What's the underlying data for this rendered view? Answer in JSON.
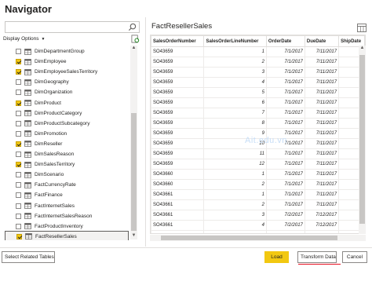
{
  "window": {
    "title": "Navigator"
  },
  "search": {
    "placeholder": ""
  },
  "display_options": {
    "label": "Display Options",
    "caret": "▼"
  },
  "tree": {
    "items": [
      {
        "label": "DimDepartmentGroup",
        "checked": false
      },
      {
        "label": "DimEmployee",
        "checked": true
      },
      {
        "label": "DimEmployeeSalesTerritory",
        "checked": true
      },
      {
        "label": "DimGeography",
        "checked": false
      },
      {
        "label": "DimOrganization",
        "checked": false
      },
      {
        "label": "DimProduct",
        "checked": true
      },
      {
        "label": "DimProductCategory",
        "checked": false
      },
      {
        "label": "DimProductSubcategory",
        "checked": false
      },
      {
        "label": "DimPromotion",
        "checked": false
      },
      {
        "label": "DimReseller",
        "checked": true
      },
      {
        "label": "DimSalesReason",
        "checked": false
      },
      {
        "label": "DimSalesTerritory",
        "checked": true
      },
      {
        "label": "DimScenario",
        "checked": false
      },
      {
        "label": "FactCurrencyRate",
        "checked": false
      },
      {
        "label": "FactFinance",
        "checked": false
      },
      {
        "label": "FactInternetSales",
        "checked": false
      },
      {
        "label": "FactInternetSalesReason",
        "checked": false
      },
      {
        "label": "FactProductInventory",
        "checked": false
      },
      {
        "label": "FactResellerSales",
        "checked": true,
        "selected": true
      }
    ]
  },
  "preview": {
    "title": "FactResellerSales",
    "columns": [
      "SalesOrderNumber",
      "SalesOrderLineNumber",
      "OrderDate",
      "DueDate",
      "ShipDate"
    ],
    "rows": [
      [
        "SO43659",
        "1",
        "7/1/2017",
        "7/11/2017",
        "7/"
      ],
      [
        "SO43659",
        "2",
        "7/1/2017",
        "7/11/2017",
        "7/"
      ],
      [
        "SO43659",
        "3",
        "7/1/2017",
        "7/11/2017",
        "7/"
      ],
      [
        "SO43659",
        "4",
        "7/1/2017",
        "7/11/2017",
        "7/"
      ],
      [
        "SO43659",
        "5",
        "7/1/2017",
        "7/11/2017",
        "7/"
      ],
      [
        "SO43659",
        "6",
        "7/1/2017",
        "7/11/2017",
        "7/"
      ],
      [
        "SO43659",
        "7",
        "7/1/2017",
        "7/11/2017",
        "7/"
      ],
      [
        "SO43659",
        "8",
        "7/1/2017",
        "7/11/2017",
        "7/"
      ],
      [
        "SO43659",
        "9",
        "7/1/2017",
        "7/11/2017",
        "7/"
      ],
      [
        "SO43659",
        "10",
        "7/1/2017",
        "7/11/2017",
        "7/"
      ],
      [
        "SO43659",
        "11",
        "7/1/2017",
        "7/11/2017",
        "7/"
      ],
      [
        "SO43659",
        "12",
        "7/1/2017",
        "7/11/2017",
        "7/"
      ],
      [
        "SO43660",
        "1",
        "7/1/2017",
        "7/11/2017",
        "7/"
      ],
      [
        "SO43660",
        "2",
        "7/1/2017",
        "7/11/2017",
        "7/"
      ],
      [
        "SO43661",
        "1",
        "7/1/2017",
        "7/11/2017",
        "7/"
      ],
      [
        "SO43661",
        "2",
        "7/1/2017",
        "7/11/2017",
        "7/"
      ],
      [
        "SO43661",
        "3",
        "7/2/2017",
        "7/12/2017",
        "7/"
      ],
      [
        "SO43661",
        "4",
        "7/2/2017",
        "7/12/2017",
        "7/"
      ],
      [
        "SO43661",
        "5",
        "7/2/2017",
        "7/12/2017",
        "7/"
      ]
    ]
  },
  "watermark": "Ait.edu.vn",
  "footer": {
    "related_label": "Select Related Tables",
    "load_label": "Load",
    "transform_label": "Transform Data",
    "cancel_label": "Cancel"
  },
  "colors": {
    "accent": "#f2c811",
    "underline": "#e81123"
  },
  "icons": {
    "search": "search-icon",
    "refresh": "refresh-icon",
    "table": "table-icon",
    "preview": "preview-options-icon"
  }
}
